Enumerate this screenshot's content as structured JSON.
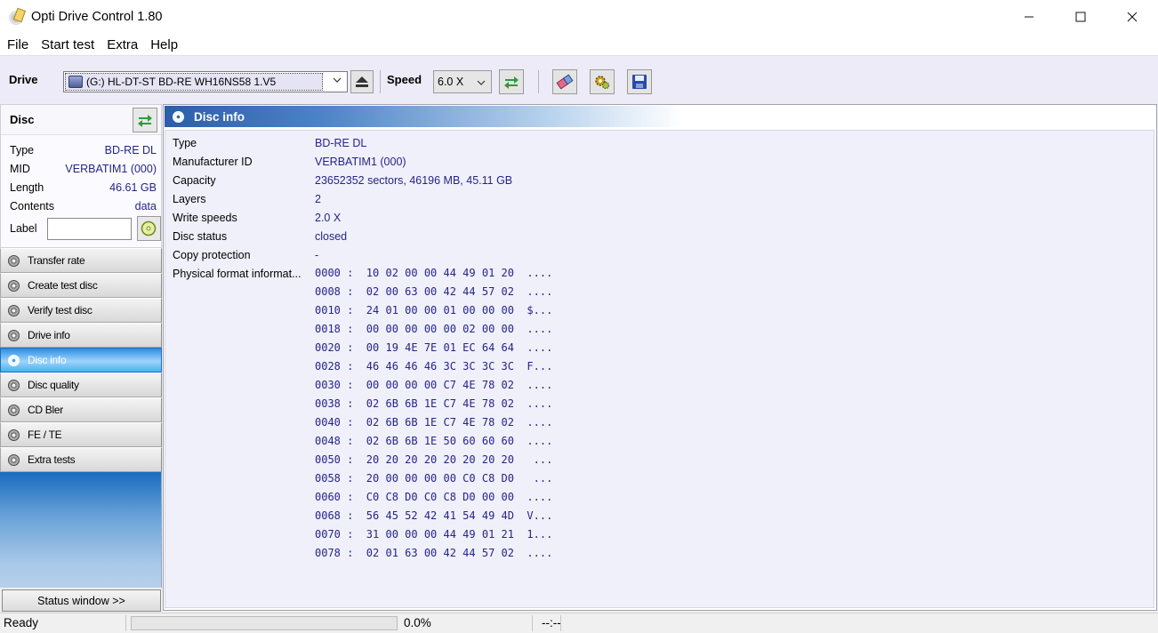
{
  "window": {
    "title": "Opti Drive Control 1.80"
  },
  "menu": [
    "File",
    "Start test",
    "Extra",
    "Help"
  ],
  "toolbar": {
    "drive_label": "Drive",
    "drive_value": "(G:)   HL-DT-ST BD-RE  WH16NS58 1.V5",
    "speed_label": "Speed",
    "speed_value": "6.0 X"
  },
  "disc": {
    "title": "Disc",
    "type_label": "Type",
    "type_value": "BD-RE DL",
    "mid_label": "MID",
    "mid_value": "VERBATIM1 (000)",
    "length_label": "Length",
    "length_value": "46.61 GB",
    "contents_label": "Contents",
    "contents_value": "data",
    "label_label": "Label"
  },
  "nav": [
    "Transfer rate",
    "Create test disc",
    "Verify test disc",
    "Drive info",
    "Disc info",
    "Disc quality",
    "CD Bler",
    "FE / TE",
    "Extra tests"
  ],
  "status_button": "Status window >>",
  "main": {
    "title": "Disc info",
    "rows": [
      {
        "key": "Type",
        "value": "BD-RE DL"
      },
      {
        "key": "Manufacturer ID",
        "value": "VERBATIM1 (000)"
      },
      {
        "key": "Capacity",
        "value": "23652352 sectors, 46196 MB, 45.11 GB"
      },
      {
        "key": "Layers",
        "value": "2"
      },
      {
        "key": "Write speeds",
        "value": "2.0 X"
      },
      {
        "key": "Disc status",
        "value": "closed"
      },
      {
        "key": "Copy protection",
        "value": "-"
      }
    ],
    "pfi_label": "Physical format informat...",
    "hex_lines": [
      "0000 :  10 02 00 00 44 49 01 20  ....",
      "0008 :  02 00 63 00 42 44 57 02  ....",
      "0010 :  24 01 00 00 01 00 00 00  $...",
      "0018 :  00 00 00 00 00 02 00 00  ....",
      "0020 :  00 19 4E 7E 01 EC 64 64  ....",
      "0028 :  46 46 46 46 3C 3C 3C 3C  F...",
      "0030 :  00 00 00 00 C7 4E 78 02  ....",
      "0038 :  02 6B 6B 1E C7 4E 78 02  ....",
      "0040 :  02 6B 6B 1E C7 4E 78 02  ....",
      "0048 :  02 6B 6B 1E 50 60 60 60  ....",
      "0050 :  20 20 20 20 20 20 20 20   ...",
      "0058 :  20 00 00 00 00 C0 C8 D0   ...",
      "0060 :  C0 C8 D0 C0 C8 D0 00 00  ....",
      "0068 :  56 45 52 42 41 54 49 4D  V...",
      "0070 :  31 00 00 00 44 49 01 21  1...",
      "0078 :  02 01 63 00 42 44 57 02  ...."
    ]
  },
  "statusbar": {
    "status": "Ready",
    "progress": "0.0%",
    "progress_value": 0.0,
    "time": "--:--"
  },
  "icons": {
    "refresh": "refresh-arrows-icon",
    "eject": "eject-icon",
    "erase": "eraser-icon",
    "settings": "gears-icon",
    "save": "floppy-disk-icon",
    "disc": "disc-icon"
  }
}
